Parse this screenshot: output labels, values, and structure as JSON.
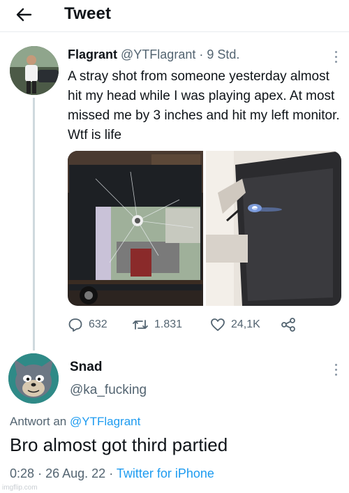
{
  "header": {
    "title": "Tweet",
    "back_icon": "arrow-left-icon"
  },
  "tweet": {
    "author_name": "Flagrant",
    "author_handle": "@YTFlagrant",
    "separator": "·",
    "time": "9 Std.",
    "text": "A stray shot from someone yesterday almost hit my head while I was playing apex. At most missed me by 3 inches and hit my left monitor. Wtf is life",
    "stats": {
      "replies": "632",
      "retweets": "1.831",
      "likes": "24,1K"
    },
    "icons": [
      "reply-icon",
      "retweet-icon",
      "like-icon",
      "share-icon"
    ]
  },
  "reply": {
    "author_name": "Snad",
    "author_handle": "@ka_fucking",
    "reply_prefix": "Antwort an",
    "reply_target": "@YTFlagrant",
    "text": "Bro almost got third partied",
    "time": "0:28",
    "date": "26 Aug. 22",
    "separator": "·",
    "client": "Twitter for iPhone"
  },
  "watermark": "imgflip.com",
  "colors": {
    "accent": "#1d9bf0",
    "secondary_text": "#536471",
    "primary_text": "#0f1419",
    "thread_line": "#cfd9de"
  }
}
